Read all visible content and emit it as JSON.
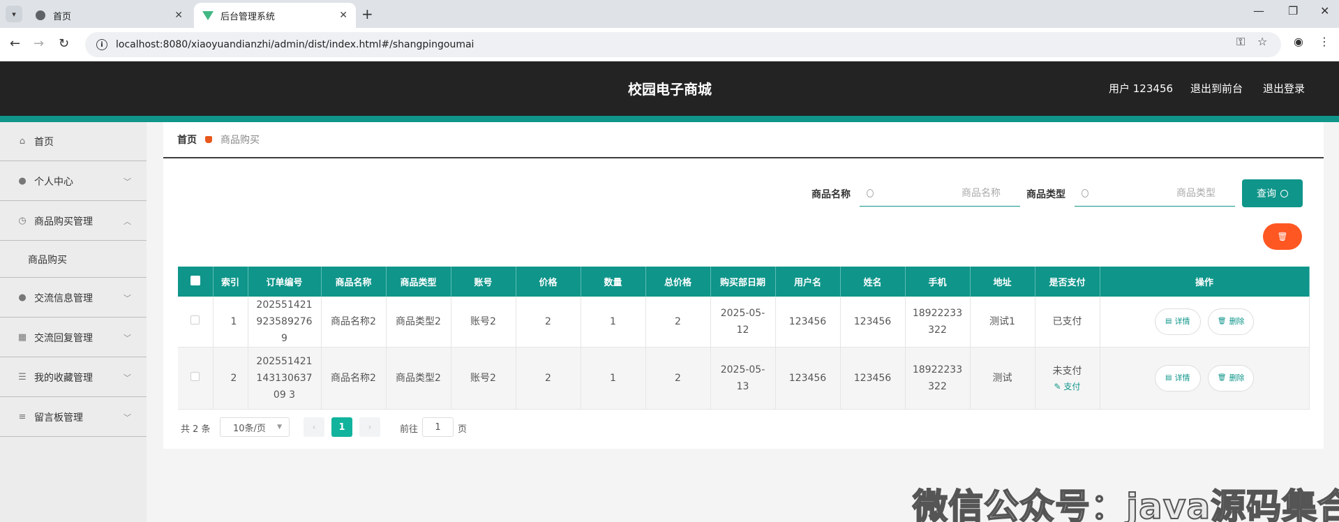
{
  "browser": {
    "tabs": [
      {
        "title": "首页",
        "active": false
      },
      {
        "title": "后台管理系统",
        "active": true
      }
    ],
    "url": "localhost:8080/xiaoyuandianzhi/admin/dist/index.html#/shangpingoumai"
  },
  "header": {
    "title": "校园电子商城",
    "user_label": "用户 123456",
    "to_front": "退出到前台",
    "logout": "退出登录"
  },
  "sidebar": {
    "items": [
      {
        "label": "首页",
        "icon": "home-icon"
      },
      {
        "label": "个人中心",
        "icon": "user-icon"
      },
      {
        "label": "商品购买管理",
        "icon": "clock-icon",
        "expanded": true
      },
      {
        "label": "商品购买",
        "sub": true
      },
      {
        "label": "交流信息管理",
        "icon": "bulb-icon"
      },
      {
        "label": "交流回复管理",
        "icon": "grid-icon"
      },
      {
        "label": "我的收藏管理",
        "icon": "sliders-icon"
      },
      {
        "label": "留言板管理",
        "icon": "menu-icon"
      }
    ]
  },
  "breadcrumb": {
    "home": "首页",
    "current": "商品购买"
  },
  "search": {
    "name_label": "商品名称",
    "name_placeholder": "商品名称",
    "type_label": "商品类型",
    "type_placeholder": "商品类型",
    "query_button": "查询"
  },
  "table": {
    "columns": [
      "索引",
      "订单编号",
      "商品名称",
      "商品类型",
      "账号",
      "价格",
      "数量",
      "总价格",
      "购买部日期",
      "用户名",
      "姓名",
      "手机",
      "地址",
      "是否支付",
      "操作"
    ],
    "rows": [
      {
        "index": "1",
        "order_no": "2025514219235892769",
        "product_name": "商品名称2",
        "product_type": "商品类型2",
        "account": "账号2",
        "price": "2",
        "quantity": "1",
        "total": "2",
        "date": "2025-05-12",
        "username": "123456",
        "name": "123456",
        "phone": "18922233322",
        "address": "测试1",
        "paid": "已支付",
        "pay_link": ""
      },
      {
        "index": "2",
        "order_no": "20255142114313063709 3",
        "product_name": "商品名称2",
        "product_type": "商品类型2",
        "account": "账号2",
        "price": "2",
        "quantity": "1",
        "total": "2",
        "date": "2025-05-13",
        "username": "123456",
        "name": "123456",
        "phone": "18922233322",
        "address": "测试",
        "paid": "未支付",
        "pay_link": "支付"
      }
    ],
    "detail_label": "详情",
    "delete_label": "删除"
  },
  "pagination": {
    "total": "共 2 条",
    "page_size": "10条/页",
    "current_page": "1",
    "goto_prefix": "前往",
    "goto_value": "1",
    "goto_suffix": "页"
  },
  "watermark": "微信公众号：java源码集合",
  "colors": {
    "accent": "#0f958a",
    "header_bg": "#232323",
    "danger": "#ff5722",
    "page_active": "#12b39c"
  }
}
